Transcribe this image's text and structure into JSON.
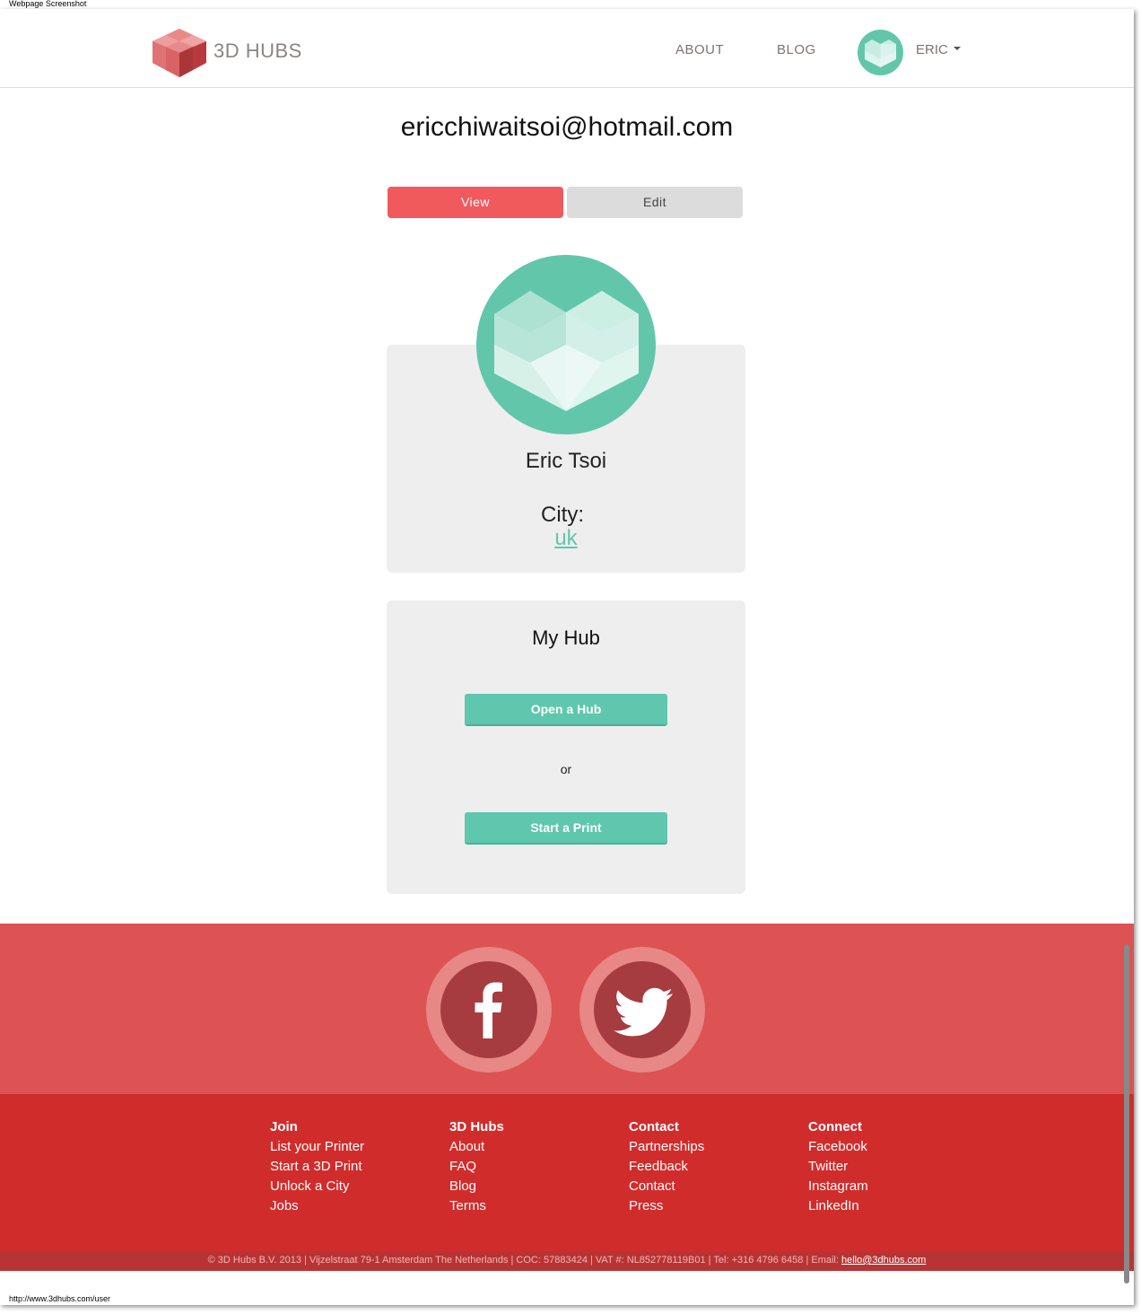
{
  "caption": "Webpage Screenshot",
  "status_url": "http://www.3dhubs.com/user",
  "colors": {
    "accent_red": "#f05a5e",
    "teal": "#5ec7ad",
    "footer_red": "#d12c2c",
    "footer_top": "#dd5252"
  },
  "header": {
    "brand": "3D HUBS",
    "nav": {
      "about": "ABOUT",
      "blog": "BLOG"
    },
    "user": "ERIC"
  },
  "profile": {
    "email": "ericchiwaitsoi@hotmail.com",
    "tabs": {
      "view": "View",
      "edit": "Edit"
    },
    "name": "Eric Tsoi",
    "city_label": "City:",
    "city_value": "uk"
  },
  "hub": {
    "title": "My Hub",
    "open_button": "Open a Hub",
    "or": "or",
    "start_button": "Start a Print"
  },
  "social": {
    "facebook_icon": "facebook-icon",
    "twitter_icon": "twitter-icon"
  },
  "footer": {
    "columns": [
      {
        "heading": "Join",
        "links": [
          "List your Printer",
          "Start a 3D Print",
          "Unlock a City",
          "Jobs"
        ]
      },
      {
        "heading": "3D Hubs",
        "links": [
          "About",
          "FAQ",
          "Blog",
          "Terms"
        ]
      },
      {
        "heading": "Contact",
        "links": [
          "Partnerships",
          "Feedback",
          "Contact",
          "Press"
        ]
      },
      {
        "heading": "Connect",
        "links": [
          "Facebook",
          "Twitter",
          "Instagram",
          "LinkedIn"
        ]
      }
    ],
    "legal": "© 3D Hubs B.V. 2013  |  Vijzelstraat 79-1 Amsterdam The Netherlands  |  COC: 57883424  |  VAT #: NL852778119B01  |  Tel: +316 4796 6458  |  Email: ",
    "email": "hello@3dhubs.com"
  }
}
